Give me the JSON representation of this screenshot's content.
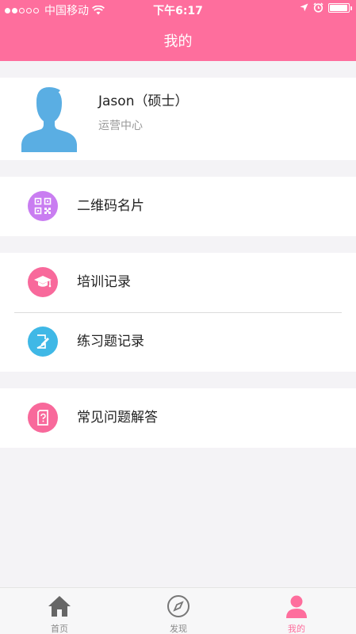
{
  "status_bar": {
    "carrier": "中国移动",
    "time": "下午6:17"
  },
  "header": {
    "title": "我的"
  },
  "profile": {
    "name": "Jason（硕士）",
    "department": "运营中心"
  },
  "menu": {
    "qr_card": "二维码名片",
    "training_records": "培训记录",
    "exercise_records": "练习题记录",
    "faq": "常见问题解答"
  },
  "tabs": [
    {
      "label": "首页",
      "icon": "home-icon",
      "active": false
    },
    {
      "label": "发现",
      "icon": "compass-icon",
      "active": false
    },
    {
      "label": "我的",
      "icon": "person-icon",
      "active": true
    }
  ],
  "colors": {
    "accent": "#fe6e9d",
    "qr_icon_bg": "#c97df1",
    "training_icon_bg": "#f8699b",
    "exercise_icon_bg": "#3fb8e6",
    "faq_icon_bg": "#f8699b",
    "avatar": "#5aaee3"
  },
  "battery_level": 0.95
}
